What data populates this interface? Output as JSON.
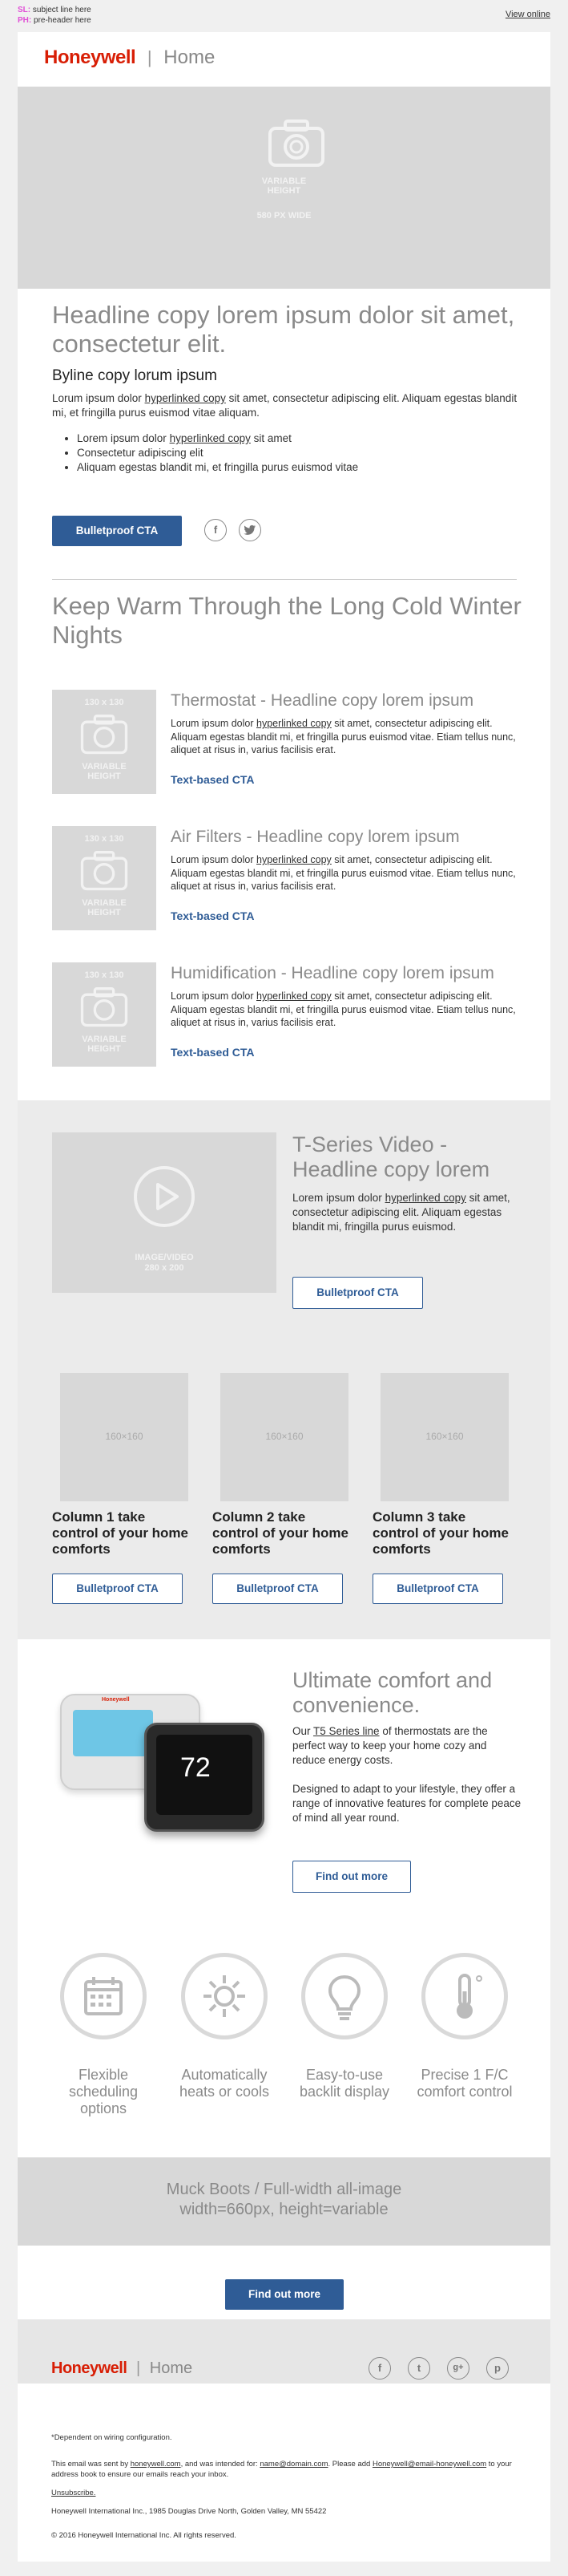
{
  "preheader": {
    "sl_label": "SL:",
    "sl_text": "subject line here",
    "ph_label": "PH:",
    "ph_text": "pre-header here",
    "view_online": "View online"
  },
  "header": {
    "brand": "Honeywell",
    "separator": "|",
    "section": "Home"
  },
  "hero": {
    "placeholder_line1": "VARIABLE",
    "placeholder_line2": "HEIGHT",
    "placeholder_line3": "580 PX WIDE"
  },
  "intro": {
    "headline": "Headline copy lorem ipsum dolor sit amet, consectetur elit.",
    "byline": "Byline copy lorum ipsum",
    "para_a": "Lorum ipsum dolor ",
    "para_link": "hyperlinked copy",
    "para_b": " sit amet, consectetur adipiscing elit. Aliquam egestas blandit mi, et fringilla purus euismod vitae aliquam.",
    "bullets": [
      {
        "a": "Lorem ipsum dolor ",
        "link": "hyperlinked copy",
        "b": " sit amet"
      },
      {
        "a": "Consectetur adipiscing elit",
        "link": "",
        "b": ""
      },
      {
        "a": "Aliquam egestas blandit mi, et fringilla purus euismod vitae",
        "link": "",
        "b": ""
      }
    ],
    "cta": "Bulletproof CTA",
    "social_icons": [
      "facebook-icon",
      "twitter-icon"
    ]
  },
  "products": {
    "headline": "Keep Warm Through the Long Cold Winter Nights",
    "thumb_size": "130 x 130",
    "thumb_line1": "VARIABLE",
    "thumb_line2": "HEIGHT",
    "items": [
      {
        "title": "Thermostat - Headline copy lorem ipsum",
        "a": "Lorum ipsum dolor ",
        "link": "hyperlinked copy",
        "b": " sit amet, consectetur adipiscing elit. Aliquam egestas blandit mi, et fringilla purus euismod vitae. Etiam tellus nunc, aliquet at risus in, varius facilisis erat.",
        "cta": "Text-based CTA"
      },
      {
        "title": "Air Filters - Headline copy lorem ipsum",
        "a": "Lorum ipsum dolor ",
        "link": "hyperlinked copy",
        "b": " sit amet, consectetur adipiscing elit. Aliquam egestas blandit mi, et fringilla purus euismod vitae. Etiam tellus nunc, aliquet at risus in, varius facilisis erat.",
        "cta": "Text-based CTA"
      },
      {
        "title": "Humidification - Headline copy lorem ipsum",
        "a": "Lorum ipsum dolor ",
        "link": "hyperlinked copy",
        "b": " sit amet, consectetur adipiscing elit. Aliquam egestas blandit mi, et fringilla purus euismod vitae. Etiam tellus nunc, aliquet at risus in, varius facilisis erat.",
        "cta": "Text-based CTA"
      }
    ]
  },
  "video": {
    "placeholder_line1": "IMAGE/VIDEO",
    "placeholder_line2": "280 x 200",
    "headline": "T-Series Video - Headline copy lorem",
    "a": "Lorem ipsum dolor ",
    "link": "hyperlinked copy",
    "b": " sit amet, consectetur adipiscing elit. Aliquam egestas blandit mi, fringilla purus euismod.",
    "cta": "Bulletproof CTA"
  },
  "columns": {
    "size": "160×160",
    "items": [
      {
        "title": "Column 1 take control of your home comforts",
        "cta": "Bulletproof CTA"
      },
      {
        "title": "Column 2 take control of your home comforts",
        "cta": "Bulletproof CTA"
      },
      {
        "title": "Column 3 take control of your home comforts",
        "cta": "Bulletproof CTA"
      }
    ]
  },
  "comfort": {
    "headline": "Ultimate comfort and convenience.",
    "p1_a": "Our ",
    "p1_link": "T5 Series line",
    "p1_b": " of thermostats are the perfect way to keep your home cozy and reduce energy costs.",
    "p2": "Designed to adapt to your lifestyle, they offer a range of innovative features for complete peace of mind all year round.",
    "cta": "Find out more",
    "device_brand": "Honeywell",
    "device_temp": "72"
  },
  "features": [
    {
      "icon": "calendar-icon",
      "label": "Flexible scheduling options"
    },
    {
      "icon": "sun-snowflake-icon",
      "label": "Automatically heats or cools"
    },
    {
      "icon": "lightbulb-icon",
      "label": "Easy-to-use backlit display"
    },
    {
      "icon": "thermometer-icon",
      "label": "Precise 1 F/C comfort control"
    }
  ],
  "banner": {
    "line1": "Muck Boots / Full-width all-image",
    "line2": "width=660px, height=variable"
  },
  "bottom_cta": "Find out more",
  "footer": {
    "brand": "Honeywell",
    "section": "Home",
    "social": [
      "f",
      "t",
      "g+",
      "p"
    ],
    "note": "*Dependent on wiring configuration.",
    "sent_a": "This email was sent by ",
    "sent_link1": "honeywell.com",
    "sent_b": ", and was intended for: ",
    "sent_link2": "name@domain.com",
    "sent_c": ". Please add ",
    "sent_link3": "Honeywell@email-honeywell.com",
    "sent_d": " to your address book to ensure our emails reach your inbox.",
    "unsubscribe": "Unsubscribe.",
    "address": "Honeywell International Inc., 1985 Douglas Drive North, Golden Valley, MN 55422",
    "copyright": "© 2016 Honeywell International Inc. All rights reserved.",
    "colors": {
      "brand_red": "#d81e05",
      "cta_blue": "#2f5c96"
    }
  }
}
